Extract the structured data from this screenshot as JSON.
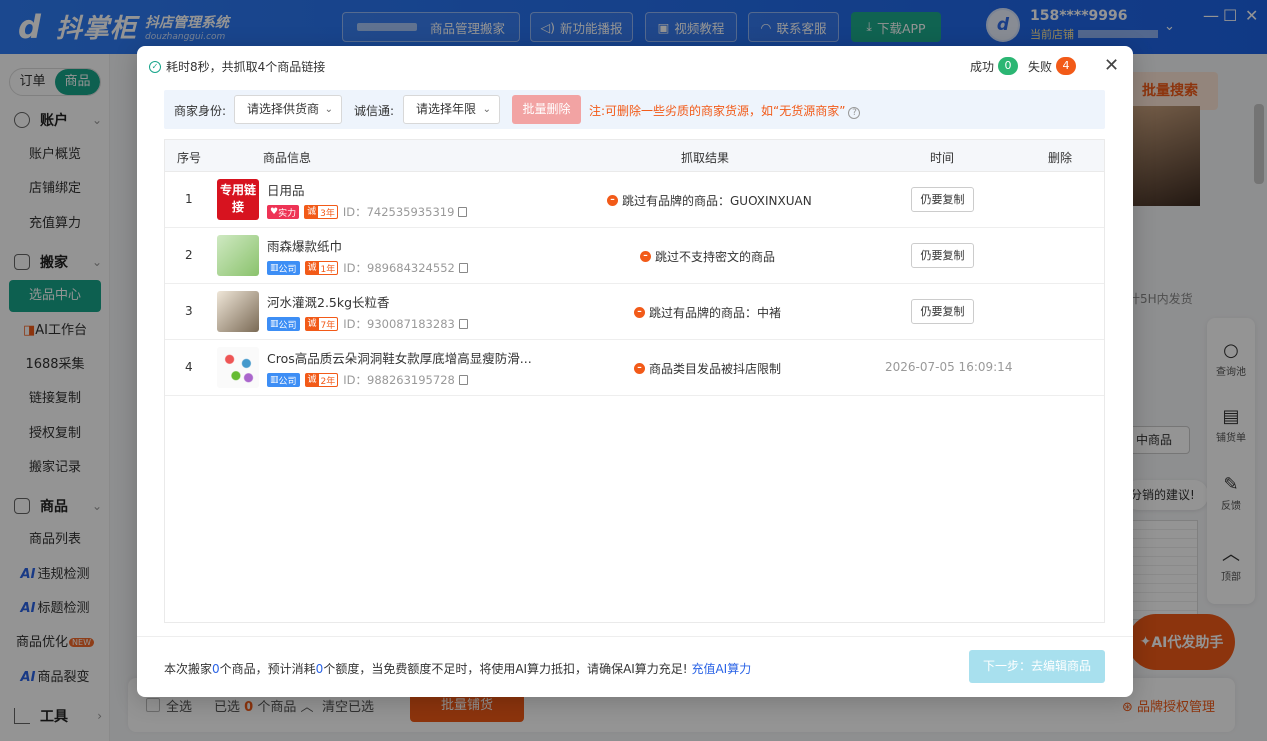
{
  "app": {
    "logo_name": "抖掌柜",
    "logo_sub": "抖店管理系统",
    "logo_domain": "douzhanggui.com",
    "nav": [
      {
        "label": "商品管理搬家"
      },
      {
        "label": "新功能播报"
      },
      {
        "label": "视频教程"
      },
      {
        "label": "联系客服"
      },
      {
        "label": "下载APP"
      }
    ],
    "user_phone": "158****9996",
    "user_store_label": "当前店铺"
  },
  "sidebar": {
    "tabs": [
      "订单",
      "商品"
    ],
    "groups": {
      "account": {
        "title": "账户",
        "items": [
          "账户概览",
          "店铺绑定",
          "充值算力"
        ]
      },
      "move": {
        "title": "搬家",
        "items": [
          "选品中心",
          "AI工作台",
          "1688采集",
          "链接复制",
          "授权复制",
          "搬家记录"
        ]
      },
      "goods": {
        "title": "商品",
        "items": [
          "商品列表",
          "违规检测",
          "标题检测",
          "商品优化",
          "商品裂变"
        ]
      },
      "tools": {
        "title": "工具"
      }
    },
    "ai_prefix": "AI",
    "new_badge": "NEW"
  },
  "background": {
    "batch_search": "批量搜索",
    "ship_note": "计5H内发货",
    "product_btn": "中商品",
    "suggest": "分销的建议!",
    "ai_helper": "AI代发助手",
    "tools": [
      "查询池",
      "铺货单",
      "反馈",
      "顶部"
    ],
    "bottom": {
      "select_all": "全选",
      "selected_prefix": "已选",
      "selected_count": "0",
      "selected_suffix": "个商品",
      "clear": "清空已选",
      "batch_btn": "批量铺货",
      "brand": "品牌授权管理"
    }
  },
  "modal": {
    "summary": "耗时8秒，共抓取4个商品链接",
    "success_label": "成功",
    "success_count": "0",
    "fail_label": "失败",
    "fail_count": "4",
    "filter": {
      "merchant_label": "商家身份:",
      "merchant_placeholder": "请选择供货商",
      "credit_label": "诚信通:",
      "credit_placeholder": "请选择年限",
      "delete_btn": "批量删除",
      "note": "注:可删除一些劣质的商家货源，如“无货源商家”"
    },
    "columns": [
      "序号",
      "商品信息",
      "抓取结果",
      "时间",
      "删除"
    ],
    "rows": [
      {
        "idx": "1",
        "name": "日用品",
        "badge": "实力",
        "year": "3年",
        "id": "ID：742535935319",
        "result": "跳过有品牌的商品：GUOXINXUAN",
        "action": "仍要复制",
        "time": "",
        "thumb": "专用链接"
      },
      {
        "idx": "2",
        "name": "雨森爆款纸巾",
        "badge": "公司",
        "year": "1年",
        "id": "ID：989684324552",
        "result": "跳过不支持密文的商品",
        "action": "仍要复制",
        "time": ""
      },
      {
        "idx": "3",
        "name": "河水灌溉2.5kg长粒香",
        "badge": "公司",
        "year": "7年",
        "id": "ID：930087183283",
        "result": "跳过有品牌的商品：中褚",
        "action": "仍要复制",
        "time": ""
      },
      {
        "idx": "4",
        "name": "Cros高品质云朵洞洞鞋女款厚底增高显瘦防滑...",
        "badge": "公司",
        "year": "2年",
        "id": "ID：988263195728",
        "result": "商品类目发品被抖店限制",
        "action": "",
        "time": "2026-07-05 16:09:14"
      }
    ],
    "credit_char": "诚",
    "footer": {
      "prefix": "本次搬家",
      "count": "0",
      "mid": "个商品，预计消耗",
      "cost": "0",
      "suffix": "个额度，当免费额度不足时，将使用AI算力抵扣，请确保AI算力充足!",
      "link": "充值AI算力"
    },
    "next_btn": "下一步：去编辑商品"
  },
  "colors": {
    "brand_blue": "#2f7df6",
    "accent_green": "#18a58b",
    "accent_orange": "#f25a18"
  }
}
